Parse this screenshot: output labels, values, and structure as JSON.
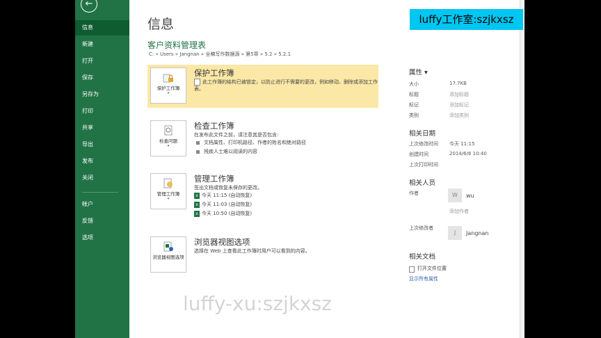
{
  "sidebar": {
    "back_icon": "arrow-left-icon",
    "items": [
      {
        "label": "信息"
      },
      {
        "label": "新建"
      },
      {
        "label": "打开"
      },
      {
        "label": "保存"
      },
      {
        "label": "另存为"
      },
      {
        "label": "打印"
      },
      {
        "label": "共享"
      },
      {
        "label": "导出"
      },
      {
        "label": "发布"
      },
      {
        "label": "关闭"
      },
      {
        "label": "帐户"
      },
      {
        "label": "反馈"
      },
      {
        "label": "选项"
      }
    ]
  },
  "page": {
    "title": "信息",
    "doc_name": "客户资料管理表",
    "path": "C: » Users » Jangnan » 全稿写作数据源 » 第5章 » 5.2 » 5.2.1"
  },
  "sections": {
    "protect": {
      "button_label": "保护工作簿",
      "title": "保护工作簿",
      "desc": "此工作簿的结构已被锁定，以防止进行不需要的更改，例如移动、删除或添加工作表。"
    },
    "inspect": {
      "button_label": "检查问题",
      "title": "检查工作簿",
      "desc": "在发布此文件之前，请注意其是否包含:",
      "items": [
        "文档属性、打印机路径、作者的姓名和绝对路径",
        "残疾人士难以阅读的内容"
      ]
    },
    "manage": {
      "button_label": "管理工作簿",
      "title": "管理工作簿",
      "desc": "签出文档或恢复未保存的更改。",
      "versions": [
        "今天 11:15 (自动恢复)",
        "今天 11:03 (自动恢复)",
        "今天 10:50 (自动恢复)"
      ]
    },
    "browser": {
      "button_label": "浏览器视图选项",
      "title": "浏览器视图选项",
      "desc": "选择在 Web 上查看此工作簿时用户可以看到的内容。"
    }
  },
  "properties": {
    "header": "属性 ▾",
    "rows": [
      {
        "key": "大小",
        "value": "17.7KB"
      },
      {
        "key": "标题",
        "value": "添加标题"
      },
      {
        "key": "标记",
        "value": "添加标记"
      },
      {
        "key": "类别",
        "value": "添加类别"
      }
    ],
    "dates_header": "相关日期",
    "dates": [
      {
        "key": "上次修改时间",
        "value": "今天 11:15"
      },
      {
        "key": "创建时间",
        "value": "2014/6/6 10:40"
      },
      {
        "key": "上次打印时间",
        "value": ""
      }
    ],
    "people_header": "相关人员",
    "author_label": "作者",
    "author_initial": "W",
    "author_name": "wu",
    "add_author": "添加作者",
    "last_modified_by_label": "上次修改者",
    "modifier_initial": "J",
    "modifier_name": "Jangnan",
    "docs_header": "相关文档",
    "open_location": "打开文件位置",
    "show_all": "显示所有属性"
  },
  "watermarks": {
    "top": "luffy工作室:szjkxsz",
    "bottom": "luffy-xu:szjkxsz"
  },
  "colors": {
    "sidebar": "#217346",
    "highlight": "#fbe8a6",
    "accent_green": "#217346",
    "link": "#2b65b0"
  }
}
